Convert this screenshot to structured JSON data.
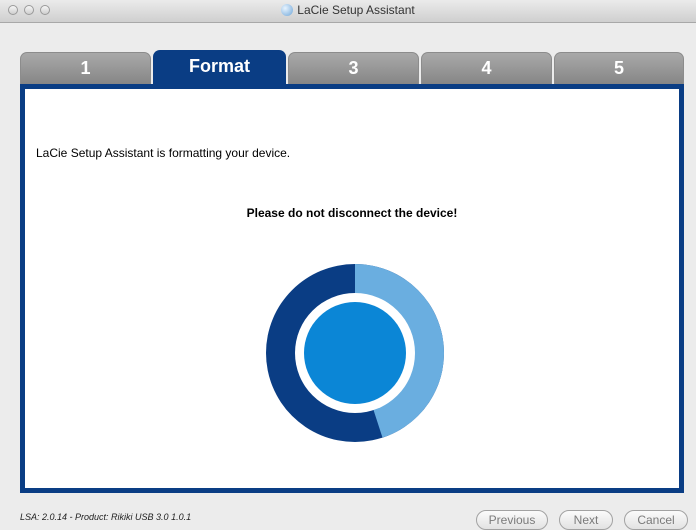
{
  "window": {
    "title": "LaCie Setup Assistant"
  },
  "tabs": [
    {
      "label": "1"
    },
    {
      "label": "Format"
    },
    {
      "label": "3"
    },
    {
      "label": "4"
    },
    {
      "label": "5"
    }
  ],
  "content": {
    "status_message": "LaCie Setup Assistant is formatting your device.",
    "warning": "Please do not disconnect the device!",
    "progress_fraction": 0.45
  },
  "footer": {
    "version_info": "LSA: 2.0.14 - Product: Rikiki USB 3.0 1.0.1",
    "previous_label": "Previous",
    "next_label": "Next",
    "cancel_label": "Cancel"
  },
  "colors": {
    "accent": "#0a3d84",
    "progress_fill": "#6aaee0",
    "progress_track": "#0a3d84",
    "progress_center": "#0b86d6"
  }
}
